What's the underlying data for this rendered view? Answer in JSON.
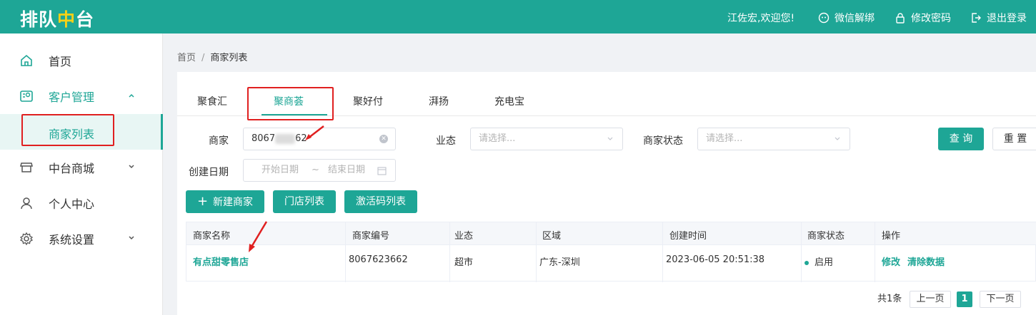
{
  "header": {
    "logo_a": "排队",
    "logo_b": "中",
    "logo_c": "台",
    "welcome": "江佐宏,欢迎您!",
    "wechat_unbind": "微信解绑",
    "change_password": "修改密码",
    "logout": "退出登录",
    "bg_color": "#1ea696",
    "logo_accent": "#f7d117"
  },
  "sidebar": {
    "items": [
      {
        "label": "首页",
        "icon": "home-icon"
      },
      {
        "label": "客户管理",
        "icon": "customer-icon"
      },
      {
        "label": "中台商城",
        "icon": "store-icon"
      },
      {
        "label": "个人中心",
        "icon": "user-icon"
      },
      {
        "label": "系统设置",
        "icon": "gear-icon"
      }
    ],
    "active_sub": "商家列表"
  },
  "breadcrumb": {
    "home": "首页",
    "sep": "/",
    "current": "商家列表"
  },
  "tabs": [
    "聚食汇",
    "聚商荟",
    "聚好付",
    "湃扬",
    "充电宝"
  ],
  "active_tab": "聚商荟",
  "filters": {
    "merchant_label": "商家",
    "merchant_value_prefix": "8067",
    "merchant_value_suffix": "62",
    "business_label": "业态",
    "business_placeholder": "请选择...",
    "status_label": "商家状态",
    "status_placeholder": "请选择...",
    "date_label": "创建日期",
    "date_start": "开始日期",
    "date_sep": "~",
    "date_end": "结束日期",
    "query": "查 询",
    "reset": "重 置"
  },
  "actions": {
    "new_merchant": "新建商家",
    "store_list": "门店列表",
    "activation_list": "激活码列表"
  },
  "table": {
    "headers": [
      "商家名称",
      "商家编号",
      "业态",
      "区域",
      "创建时间",
      "商家状态",
      "操作"
    ],
    "rows": [
      {
        "name": "有点甜零售店",
        "code": "8067623662",
        "business": "超市",
        "region": "广东-深圳",
        "created": "2023-06-05 20:51:38",
        "status": "启用",
        "edit": "修改",
        "clear": "清除数据"
      }
    ]
  },
  "pagination": {
    "total": "共1条",
    "prev": "上一页",
    "current": "1",
    "next": "下一页"
  }
}
